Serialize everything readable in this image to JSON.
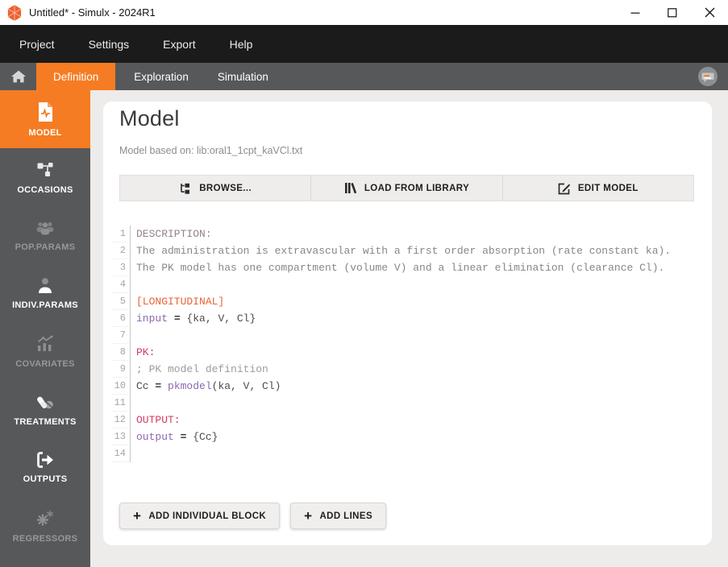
{
  "window": {
    "title": "Untitled* - Simulx - 2024R1"
  },
  "menu": {
    "items": [
      "Project",
      "Settings",
      "Export",
      "Help"
    ]
  },
  "tabs": {
    "items": [
      {
        "label": "Definition",
        "active": true
      },
      {
        "label": "Exploration",
        "active": false
      },
      {
        "label": "Simulation",
        "active": false
      }
    ]
  },
  "sidebar": {
    "items": [
      {
        "label": "MODEL",
        "icon": "model-document-icon",
        "state": "active"
      },
      {
        "label": "OCCASIONS",
        "icon": "occasions-nodes-icon",
        "state": "enabled"
      },
      {
        "label": "POP.PARAMS",
        "icon": "population-group-icon",
        "state": "disabled"
      },
      {
        "label": "INDIV.PARAMS",
        "icon": "individual-person-icon",
        "state": "enabled"
      },
      {
        "label": "COVARIATES",
        "icon": "covariates-chart-icon",
        "state": "disabled"
      },
      {
        "label": "TREATMENTS",
        "icon": "treatments-pills-icon",
        "state": "enabled"
      },
      {
        "label": "OUTPUTS",
        "icon": "outputs-arrow-icon",
        "state": "enabled"
      },
      {
        "label": "REGRESSORS",
        "icon": "regressors-gears-icon",
        "state": "disabled"
      }
    ]
  },
  "main": {
    "title": "Model",
    "subtitle": "Model based on: lib:oral1_1cpt_kaVCl.txt",
    "toolbar": {
      "browse_label": "BROWSE...",
      "load_label": "LOAD FROM LIBRARY",
      "edit_label": "EDIT MODEL"
    },
    "actions": {
      "plus_glyph": "+",
      "add_block_label": "ADD INDIVIDUAL BLOCK",
      "add_lines_label": "ADD LINES"
    },
    "editor": {
      "lines": [
        {
          "num": "1",
          "tokens": [
            {
              "s": "DESCRIPTION:",
              "c": "section"
            }
          ]
        },
        {
          "num": "2",
          "tokens": [
            {
              "s": "The administration is extravascular with a first order absorption (rate constant ka).",
              "c": "desc"
            }
          ]
        },
        {
          "num": "3",
          "tokens": [
            {
              "s": "The PK model has one compartment (volume V) and a linear elimination (clearance Cl).",
              "c": "desc"
            }
          ]
        },
        {
          "num": "4",
          "tokens": []
        },
        {
          "num": "5",
          "tokens": [
            {
              "s": "[LONGITUDINAL]",
              "c": "block"
            }
          ]
        },
        {
          "num": "6",
          "tokens": [
            {
              "s": "input",
              "c": "kw"
            },
            {
              "s": " ",
              "c": "plain"
            },
            {
              "s": "=",
              "c": "op"
            },
            {
              "s": " {ka, V, Cl}",
              "c": "plain"
            }
          ]
        },
        {
          "num": "7",
          "tokens": []
        },
        {
          "num": "8",
          "tokens": [
            {
              "s": "PK:",
              "c": "sec2"
            }
          ]
        },
        {
          "num": "9",
          "tokens": [
            {
              "s": "; PK model definition",
              "c": "comment"
            }
          ]
        },
        {
          "num": "10",
          "tokens": [
            {
              "s": "Cc ",
              "c": "plain"
            },
            {
              "s": "=",
              "c": "op"
            },
            {
              "s": " ",
              "c": "plain"
            },
            {
              "s": "pkmodel",
              "c": "kw"
            },
            {
              "s": "(ka, V, Cl)",
              "c": "plain"
            }
          ]
        },
        {
          "num": "11",
          "tokens": []
        },
        {
          "num": "12",
          "tokens": [
            {
              "s": "OUTPUT:",
              "c": "sec2"
            }
          ]
        },
        {
          "num": "13",
          "tokens": [
            {
              "s": "output",
              "c": "kw"
            },
            {
              "s": " ",
              "c": "plain"
            },
            {
              "s": "=",
              "c": "op"
            },
            {
              "s": " {Cc}",
              "c": "plain"
            }
          ]
        },
        {
          "num": "14",
          "tokens": []
        }
      ]
    }
  },
  "colors": {
    "accent": "#f57c22",
    "menubar_bg": "#1b1b1b",
    "tabbar_bg": "#57585a",
    "sidebar_bg": "#57585a",
    "content_bg": "#edeceb",
    "tok_section": "#93838d",
    "tok_desc": "#878787",
    "tok_block": "#e8633a",
    "tok_sec2": "#d23b63",
    "tok_kw": "#8c68ae",
    "tok_comment": "#9c9c9c",
    "tok_plain": "#4c4c4c"
  }
}
